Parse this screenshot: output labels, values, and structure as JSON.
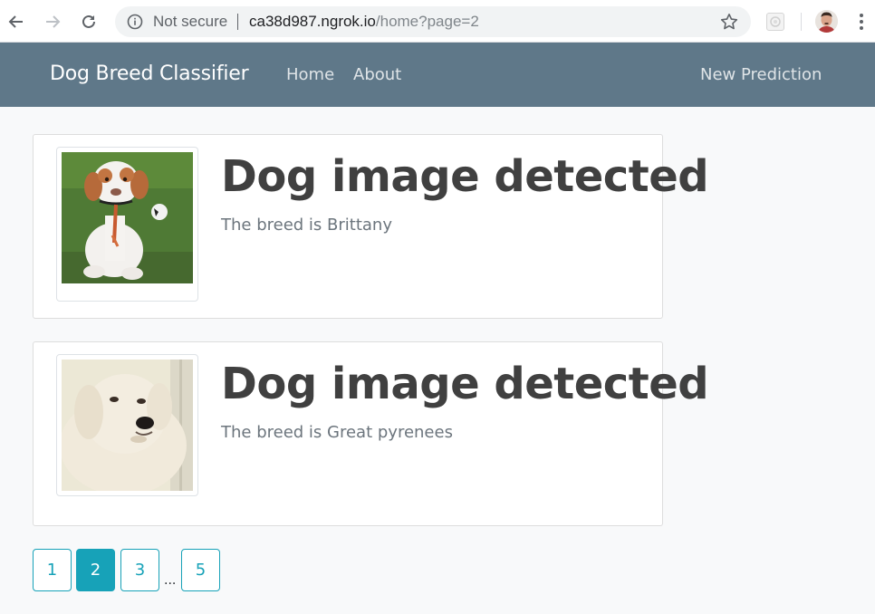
{
  "browser": {
    "security_label": "Not secure",
    "url_host": "ca38d987.ngrok.io",
    "url_path": "/home?page=2",
    "icons": [
      "back-arrow-icon",
      "forward-arrow-icon",
      "reload-icon",
      "info-icon",
      "star-icon",
      "extension-icon",
      "profile-avatar",
      "menu-kebab-icon"
    ]
  },
  "navbar": {
    "brand": "Dog Breed Classifier",
    "links": [
      "Home",
      "About"
    ],
    "right_link": "New Prediction",
    "background": "#5f7889"
  },
  "results": [
    {
      "title": "Dog image detected",
      "text": "The breed is Brittany",
      "image": "brittany-dog-photo"
    },
    {
      "title": "Dog image detected",
      "text": "The breed is Great pyrenees",
      "image": "great-pyrenees-dog-photo"
    }
  ],
  "pagination": {
    "pages": [
      "1",
      "2",
      "3",
      "5"
    ],
    "current": "2",
    "ellipsis": "...",
    "accent": "#17a2b8"
  }
}
